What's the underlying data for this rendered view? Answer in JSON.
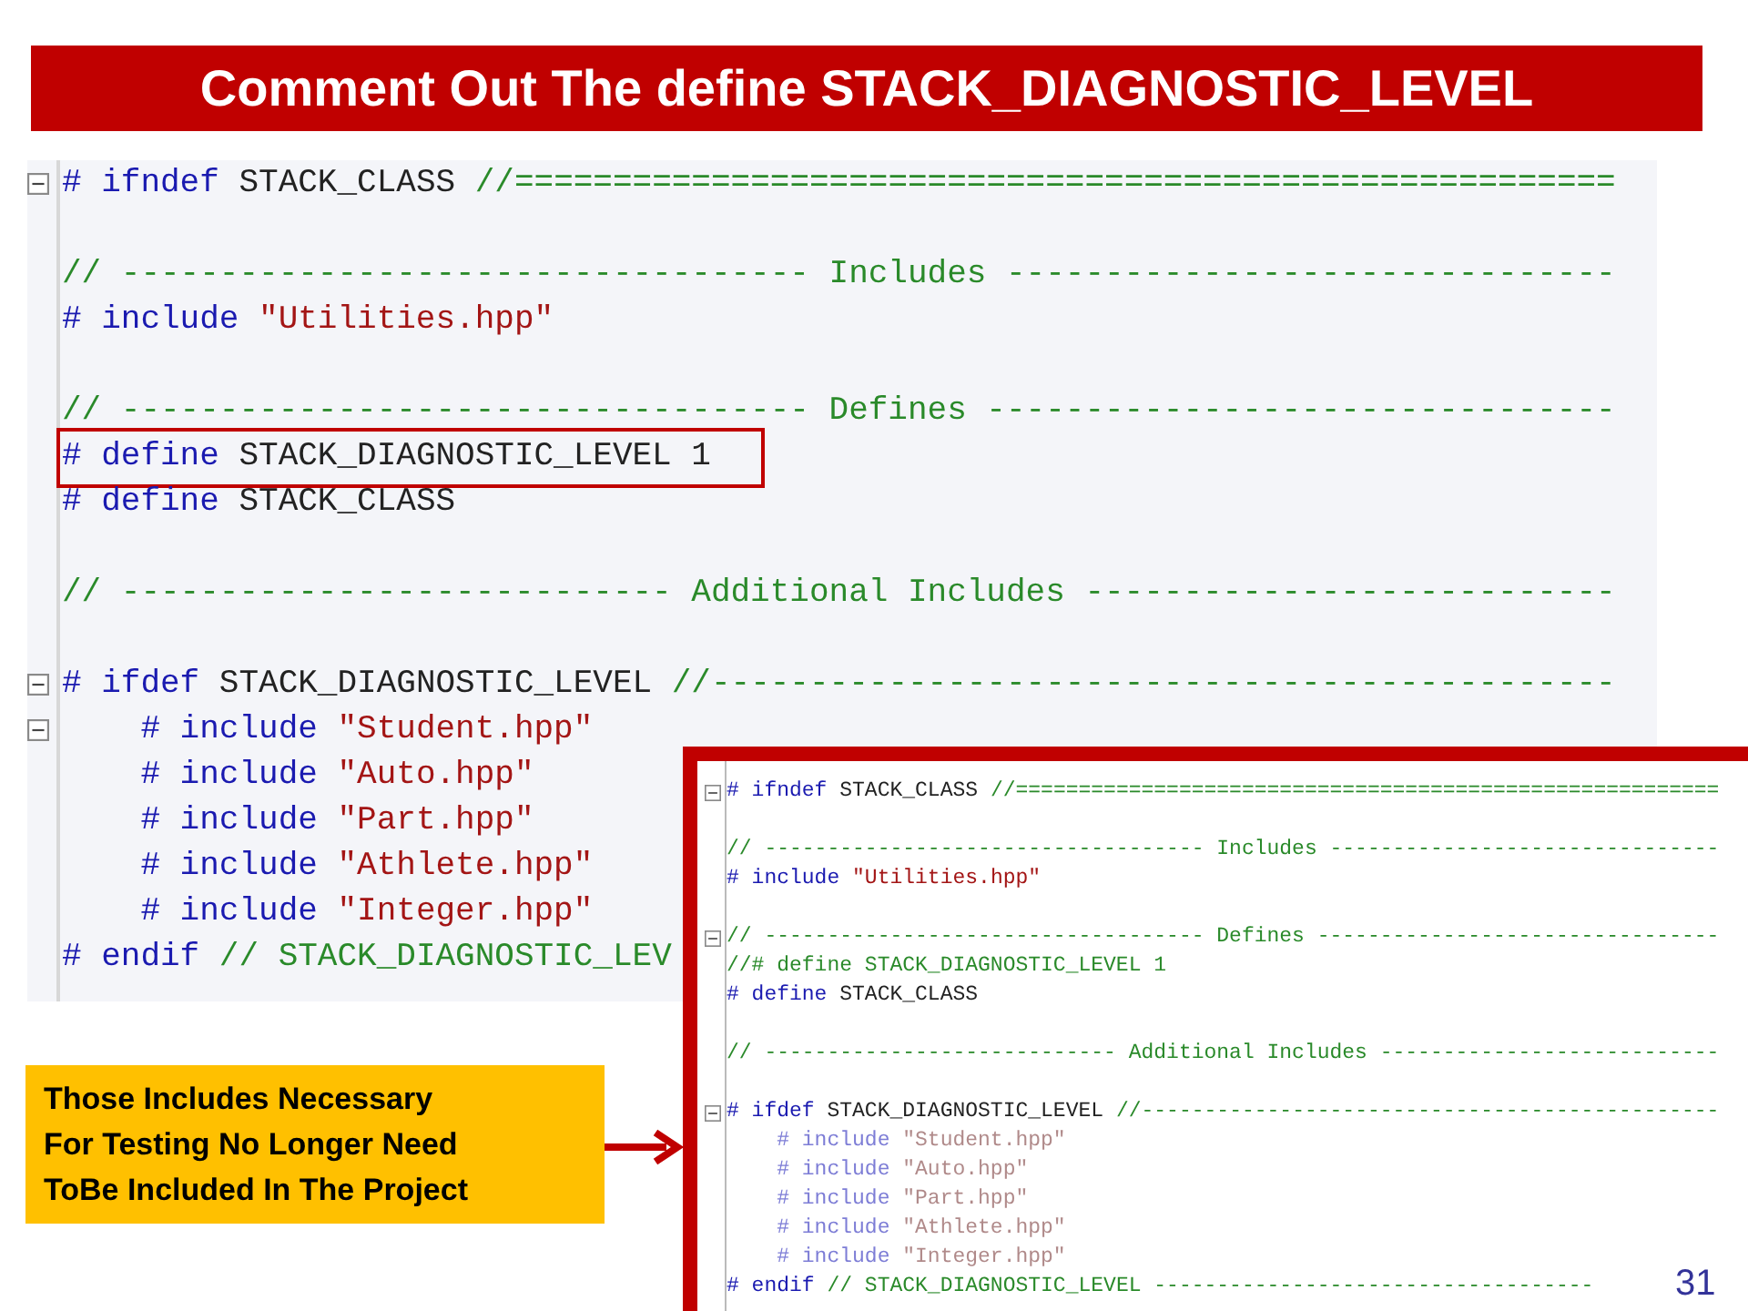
{
  "slide": {
    "title": "Comment Out The define STACK_DIAGNOSTIC_LEVEL",
    "page_number": "31"
  },
  "editor": {
    "lines": [
      {
        "kind": "code",
        "fold": true,
        "highlighted": false,
        "segments": [
          {
            "kind": "keyword",
            "text": "# ifndef"
          },
          {
            "kind": "identifier",
            "text": " STACK_CLASS "
          },
          {
            "kind": "comment",
            "text": "//========================================================"
          }
        ]
      },
      {
        "kind": "blank"
      },
      {
        "kind": "code",
        "fold": false,
        "highlighted": false,
        "segments": [
          {
            "kind": "comment",
            "text": "// ----------------------------------- Includes -------------------------------"
          }
        ]
      },
      {
        "kind": "code",
        "fold": false,
        "highlighted": false,
        "segments": [
          {
            "kind": "keyword",
            "text": "# include"
          },
          {
            "kind": "string",
            "text": " \"Utilities.hpp\""
          }
        ]
      },
      {
        "kind": "blank"
      },
      {
        "kind": "code",
        "fold": false,
        "highlighted": false,
        "segments": [
          {
            "kind": "comment",
            "text": "// ----------------------------------- Defines --------------------------------"
          }
        ]
      },
      {
        "kind": "code",
        "fold": false,
        "highlighted": true,
        "segments": [
          {
            "kind": "keyword",
            "text": "# define"
          },
          {
            "kind": "identifier",
            "text": " STACK_DIAGNOSTIC_LEVEL 1"
          }
        ]
      },
      {
        "kind": "code",
        "fold": false,
        "highlighted": false,
        "segments": [
          {
            "kind": "keyword",
            "text": "# define"
          },
          {
            "kind": "identifier",
            "text": " STACK_CLASS"
          }
        ]
      },
      {
        "kind": "blank"
      },
      {
        "kind": "code",
        "fold": false,
        "highlighted": false,
        "segments": [
          {
            "kind": "comment",
            "text": "// ---------------------------- Additional Includes ---------------------------"
          }
        ]
      },
      {
        "kind": "blank"
      },
      {
        "kind": "code",
        "fold": true,
        "highlighted": false,
        "segments": [
          {
            "kind": "keyword",
            "text": "# ifdef"
          },
          {
            "kind": "identifier",
            "text": " STACK_DIAGNOSTIC_LEVEL "
          },
          {
            "kind": "comment",
            "text": "//----------------------------------------------"
          }
        ]
      },
      {
        "kind": "code",
        "fold": true,
        "highlighted": false,
        "segments": [
          {
            "kind": "keyword",
            "text": "    # include"
          },
          {
            "kind": "string",
            "text": " \"Student.hpp\""
          }
        ]
      },
      {
        "kind": "code",
        "fold": false,
        "highlighted": false,
        "segments": [
          {
            "kind": "keyword",
            "text": "    # include"
          },
          {
            "kind": "string",
            "text": " \"Auto.hpp\""
          }
        ]
      },
      {
        "kind": "code",
        "fold": false,
        "highlighted": false,
        "segments": [
          {
            "kind": "keyword",
            "text": "    # include"
          },
          {
            "kind": "string",
            "text": " \"Part.hpp\""
          }
        ]
      },
      {
        "kind": "code",
        "fold": false,
        "highlighted": false,
        "segments": [
          {
            "kind": "keyword",
            "text": "    # include"
          },
          {
            "kind": "string",
            "text": " \"Athlete.hpp\""
          }
        ]
      },
      {
        "kind": "code",
        "fold": false,
        "highlighted": false,
        "segments": [
          {
            "kind": "keyword",
            "text": "    # include"
          },
          {
            "kind": "string",
            "text": " \"Integer.hpp\""
          }
        ]
      },
      {
        "kind": "code",
        "fold": false,
        "highlighted": false,
        "segments": [
          {
            "kind": "keyword",
            "text": "# endif"
          },
          {
            "kind": "comment",
            "text": " // STACK_DIAGNOSTIC_LEV"
          }
        ]
      }
    ]
  },
  "inset_editor": {
    "lines": [
      {
        "kind": "code",
        "fold": true,
        "inactive": false,
        "segments": [
          {
            "kind": "keyword",
            "text": "# ifndef"
          },
          {
            "kind": "identifier",
            "text": " STACK_CLASS "
          },
          {
            "kind": "comment",
            "text": "//========================================================"
          }
        ]
      },
      {
        "kind": "blank"
      },
      {
        "kind": "code",
        "fold": false,
        "inactive": false,
        "segments": [
          {
            "kind": "comment",
            "text": "// ----------------------------------- Includes -------------------------------"
          }
        ]
      },
      {
        "kind": "code",
        "fold": false,
        "inactive": false,
        "segments": [
          {
            "kind": "keyword",
            "text": "# include"
          },
          {
            "kind": "string",
            "text": " \"Utilities.hpp\""
          }
        ]
      },
      {
        "kind": "blank"
      },
      {
        "kind": "code",
        "fold": true,
        "inactive": false,
        "segments": [
          {
            "kind": "comment",
            "text": "// ----------------------------------- Defines --------------------------------"
          }
        ]
      },
      {
        "kind": "code",
        "fold": false,
        "inactive": false,
        "segments": [
          {
            "kind": "comment",
            "text": "//# define STACK_DIAGNOSTIC_LEVEL 1"
          }
        ]
      },
      {
        "kind": "code",
        "fold": false,
        "inactive": false,
        "segments": [
          {
            "kind": "keyword",
            "text": "# define"
          },
          {
            "kind": "identifier",
            "text": " STACK_CLASS"
          }
        ]
      },
      {
        "kind": "blank"
      },
      {
        "kind": "code",
        "fold": false,
        "inactive": false,
        "segments": [
          {
            "kind": "comment",
            "text": "// ---------------------------- Additional Includes ---------------------------"
          }
        ]
      },
      {
        "kind": "blank"
      },
      {
        "kind": "code",
        "fold": true,
        "inactive": false,
        "segments": [
          {
            "kind": "keyword",
            "text": "# ifdef"
          },
          {
            "kind": "identifier",
            "text": " STACK_DIAGNOSTIC_LEVEL "
          },
          {
            "kind": "comment",
            "text": "//----------------------------------------------"
          }
        ]
      },
      {
        "kind": "code",
        "fold": false,
        "inactive": true,
        "segments": [
          {
            "kind": "keyword",
            "text": "    # include"
          },
          {
            "kind": "string",
            "text": " \"Student.hpp\""
          }
        ]
      },
      {
        "kind": "code",
        "fold": false,
        "inactive": true,
        "segments": [
          {
            "kind": "keyword",
            "text": "    # include"
          },
          {
            "kind": "string",
            "text": " \"Auto.hpp\""
          }
        ]
      },
      {
        "kind": "code",
        "fold": false,
        "inactive": true,
        "segments": [
          {
            "kind": "keyword",
            "text": "    # include"
          },
          {
            "kind": "string",
            "text": " \"Part.hpp\""
          }
        ]
      },
      {
        "kind": "code",
        "fold": false,
        "inactive": true,
        "segments": [
          {
            "kind": "keyword",
            "text": "    # include"
          },
          {
            "kind": "string",
            "text": " \"Athlete.hpp\""
          }
        ]
      },
      {
        "kind": "code",
        "fold": false,
        "inactive": true,
        "segments": [
          {
            "kind": "keyword",
            "text": "    # include"
          },
          {
            "kind": "string",
            "text": " \"Integer.hpp\""
          }
        ]
      },
      {
        "kind": "code",
        "fold": false,
        "inactive": false,
        "segments": [
          {
            "kind": "keyword",
            "text": "# endif"
          },
          {
            "kind": "comment",
            "text": " // STACK_DIAGNOSTIC_LEVEL -----------------------------------"
          }
        ]
      }
    ]
  },
  "callout": {
    "lines": [
      "Those Includes Necessary",
      "For Testing No Longer Need",
      "ToBe Included In The Project"
    ]
  }
}
